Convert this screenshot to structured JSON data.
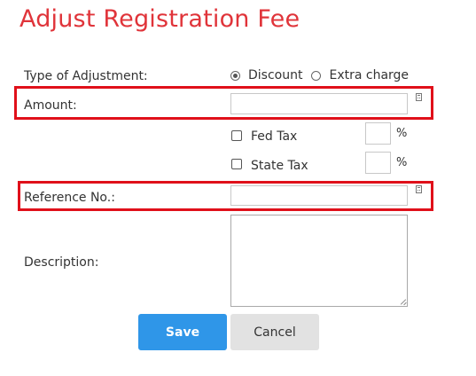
{
  "page_title": "Adjust Registration Fee",
  "form": {
    "type_of_adjustment": {
      "label": "Type of Adjustment:",
      "options": [
        {
          "label": "Discount",
          "selected": true
        },
        {
          "label": "Extra charge",
          "selected": false
        }
      ]
    },
    "amount": {
      "label": "Amount:",
      "value": ""
    },
    "fed_tax": {
      "label": "Fed Tax",
      "checked": false,
      "percent_value": "",
      "unit": "%"
    },
    "state_tax": {
      "label": "State Tax",
      "checked": false,
      "percent_value": "",
      "unit": "%"
    },
    "reference_no": {
      "label": "Reference No.:",
      "value": ""
    },
    "description": {
      "label": "Description:",
      "value": ""
    }
  },
  "buttons": {
    "save_label": "Save",
    "cancel_label": "Cancel"
  },
  "colors": {
    "title": "#e0343a",
    "highlight_border": "#e0101a",
    "save_button": "#2f96e8",
    "cancel_button": "#e2e2e2"
  },
  "icons": {
    "amount_icon": "calculator-icon",
    "reference_icon": "calculator-icon"
  }
}
